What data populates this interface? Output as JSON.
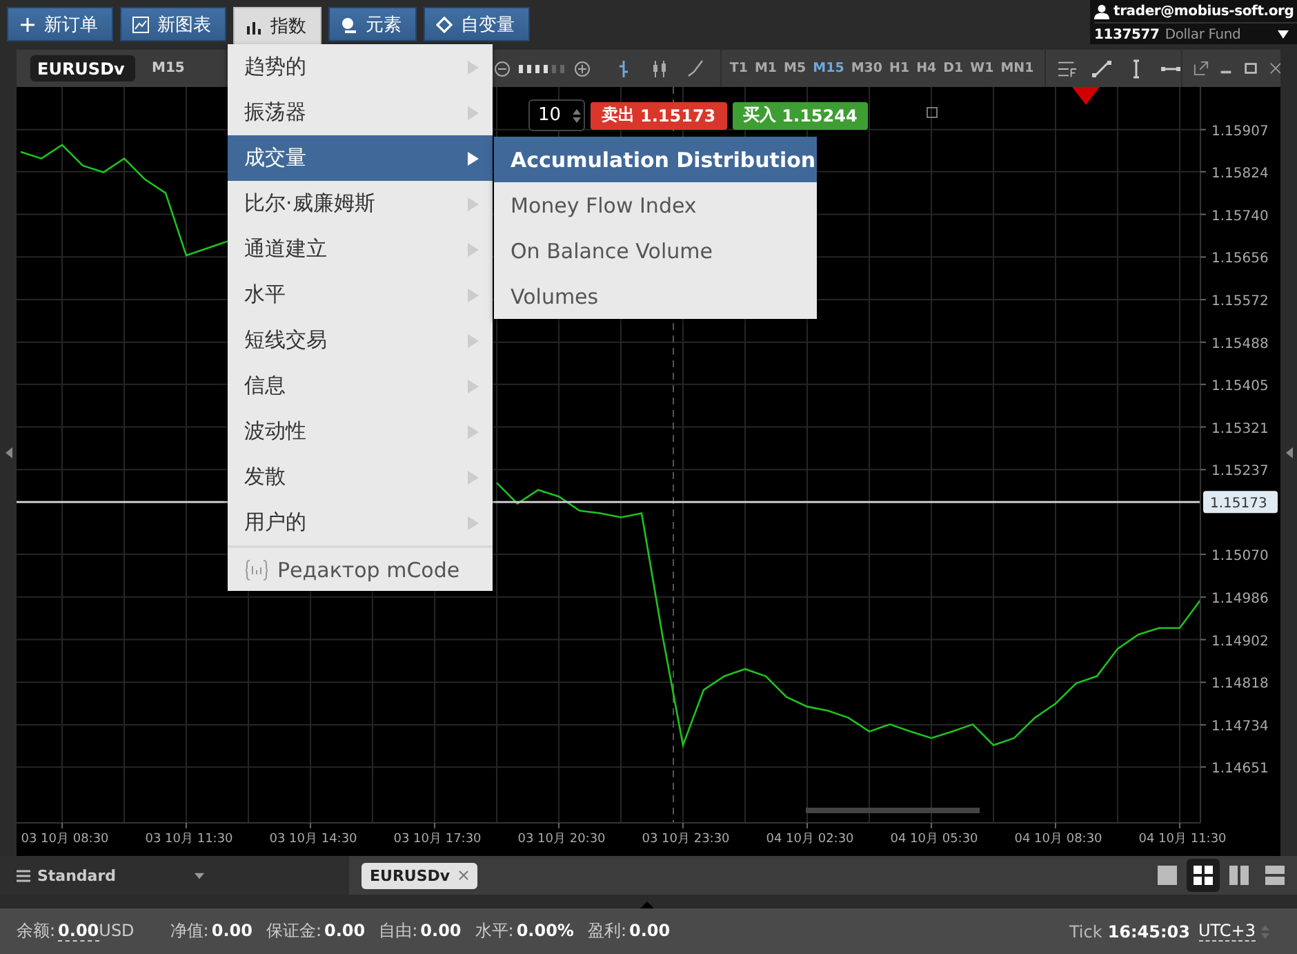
{
  "toolbar_buttons": [
    {
      "kind": "plus",
      "label": "新订单",
      "selected": false
    },
    {
      "kind": "chart",
      "label": "新图表",
      "selected": false
    },
    {
      "kind": "bars",
      "label": "指数",
      "selected": true
    },
    {
      "kind": "element",
      "label": "元素",
      "selected": false
    },
    {
      "kind": "diamond",
      "label": "自变量",
      "selected": false
    }
  ],
  "account": {
    "user": "trader@mobius-soft.org",
    "number": "1137577",
    "name": "Dollar Fund"
  },
  "chart_window": {
    "symbol": "EURUSDv",
    "period": "M15",
    "chart_types": [
      {
        "kind": "bar",
        "selected": true
      },
      {
        "kind": "candle",
        "selected": false
      },
      {
        "kind": "line",
        "selected": false
      }
    ],
    "timeframes": [
      {
        "label": "T1",
        "selected": false
      },
      {
        "label": "M1",
        "selected": false
      },
      {
        "label": "M5",
        "selected": false
      },
      {
        "label": "M15",
        "selected": true
      },
      {
        "label": "M30",
        "selected": false
      },
      {
        "label": "H1",
        "selected": false
      },
      {
        "label": "H4",
        "selected": false
      },
      {
        "label": "D1",
        "selected": false
      },
      {
        "label": "W1",
        "selected": false
      },
      {
        "label": "MN1",
        "selected": false
      }
    ],
    "trade": {
      "volume": "10",
      "sell_label": "卖出",
      "sell_price": "1.15173",
      "buy_label": "买入",
      "buy_price": "1.15244"
    },
    "chart_data": {
      "type": "line",
      "grid": true,
      "ylim": [
        1.14541,
        1.15991
      ],
      "categories": [
        null,
        null,
        "03 10月 08:30",
        null,
        null,
        null,
        null,
        null,
        "03 10月 11:30",
        null,
        null,
        null,
        null,
        null,
        "03 10月 14:30",
        null,
        null,
        null,
        null,
        null,
        "03 10月 17:30",
        null,
        null,
        null,
        null,
        null,
        "03 10月 20:30",
        null,
        null,
        null,
        null,
        null,
        "03 10月 23:30",
        null,
        null,
        null,
        null,
        null,
        "04 10月 02:30",
        null,
        null,
        null,
        null,
        null,
        "04 10月 05:30",
        null,
        null,
        null,
        null,
        null,
        "04 10月 08:30",
        null,
        null,
        null,
        null,
        null,
        "04 10月 11:30",
        null
      ],
      "yticks": [
        1.15907,
        1.15824,
        {
          "value": 1.1574,
          "label": "1.15740"
        },
        1.15656,
        1.15572,
        1.15488,
        1.15405,
        1.15321,
        1.15237,
        {
          "value": 1.1507,
          "label": "1.15070"
        },
        1.14986,
        1.14902,
        1.14818,
        1.14734,
        1.14651
      ],
      "series": [
        {
          "color": "#1fc21f",
          "values": [
            1.15863,
            1.1585,
            1.15877,
            1.15836,
            1.15823,
            1.1585,
            1.15809,
            1.15782,
            1.15659,
            1.15673,
            1.15687,
            null,
            null,
            null,
            null,
            null,
            null,
            null,
            null,
            null,
            null,
            null,
            null,
            1.15211,
            1.1517,
            1.15197,
            1.15184,
            1.15156,
            1.15151,
            1.15143,
            1.15151,
            1.14912,
            1.14694,
            1.14803,
            1.1483,
            1.14844,
            1.1483,
            1.14789,
            1.1477,
            1.14762,
            1.14748,
            1.14721,
            1.14735,
            1.14721,
            1.14708,
            1.14721,
            1.14735,
            1.14694,
            1.14708,
            1.14748,
            1.14776,
            1.14816,
            1.1483,
            1.14884,
            1.14912,
            1.14925,
            1.14925,
            1.1498
          ]
        }
      ],
      "ref_lines": [
        {
          "axis": "y",
          "value": 1.15173,
          "label": "1.15173"
        }
      ]
    }
  },
  "menu": {
    "items": [
      {
        "kind": "submenu",
        "label": "趋势的",
        "selected": false
      },
      {
        "kind": "submenu",
        "label": "振荡器",
        "selected": false
      },
      {
        "kind": "submenu",
        "label": "成交量",
        "selected": true
      },
      {
        "kind": "submenu",
        "label": "比尔·威廉姆斯",
        "selected": false
      },
      {
        "kind": "submenu",
        "label": "通道建立",
        "selected": false
      },
      {
        "kind": "submenu",
        "label": "水平",
        "selected": false
      },
      {
        "kind": "submenu",
        "label": "短线交易",
        "selected": false
      },
      {
        "kind": "submenu",
        "label": "信息",
        "selected": false
      },
      {
        "kind": "submenu",
        "label": "波动性",
        "selected": false
      },
      {
        "kind": "submenu",
        "label": "发散",
        "selected": false
      },
      {
        "kind": "submenu",
        "label": "用户的",
        "selected": false
      },
      {
        "kind": "editor",
        "label": "Редактор mCode",
        "selected": false
      }
    ],
    "submenu": [
      {
        "label": "Accumulation Distribution",
        "selected": true
      },
      {
        "label": "Money Flow Index",
        "selected": false
      },
      {
        "label": "On Balance Volume",
        "selected": false
      },
      {
        "label": "Volumes",
        "selected": false
      }
    ]
  },
  "bottom_bar": {
    "profile": "Standard",
    "tabs": [
      {
        "label": "EURUSDv",
        "selected": true
      }
    ],
    "layouts": [
      {
        "kind": "single",
        "selected": false
      },
      {
        "kind": "grid",
        "selected": true
      },
      {
        "kind": "columns",
        "selected": false
      },
      {
        "kind": "rows",
        "selected": false
      }
    ]
  },
  "status_bar": {
    "items": [
      {
        "label": "余额:",
        "value": "0.00",
        "unit": "USD"
      },
      {
        "label": "净值:",
        "value": "0.00"
      },
      {
        "label": "保证金:",
        "value": "0.00"
      },
      {
        "label": "自由:",
        "value": "0.00"
      },
      {
        "label": "水平:",
        "value": "0.00%"
      },
      {
        "label": "盈利:",
        "value": "0.00"
      }
    ],
    "tick_label": "Tick",
    "time": "16:45:03",
    "timezone": "UTC+3"
  }
}
